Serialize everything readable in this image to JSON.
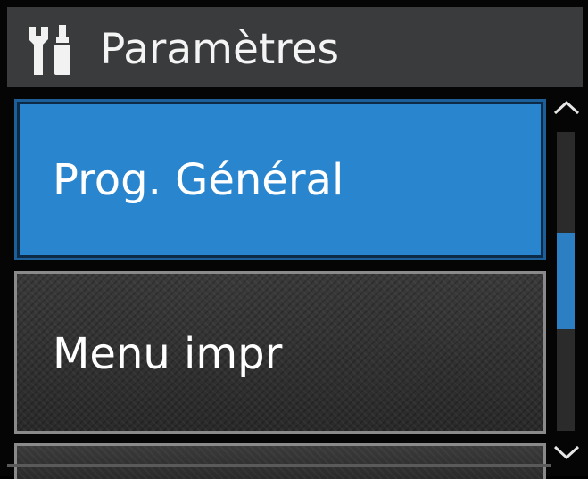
{
  "header": {
    "icon": "settings-tools-icon",
    "title": "Paramètres"
  },
  "menu": {
    "items": [
      {
        "label": "Prog. Général",
        "selected": true
      },
      {
        "label": "Menu impr",
        "selected": false
      },
      {
        "label": "",
        "selected": false
      }
    ]
  },
  "scrollbar": {
    "up_icon": "chevron-up-icon",
    "down_icon": "chevron-down-icon",
    "position_fraction": 0.34,
    "visible_fraction": 0.32
  },
  "colors": {
    "selected": "#2a85cf",
    "header": "#3a3b3d",
    "text": "#ffffff",
    "thumb": "#2d7fc4"
  }
}
